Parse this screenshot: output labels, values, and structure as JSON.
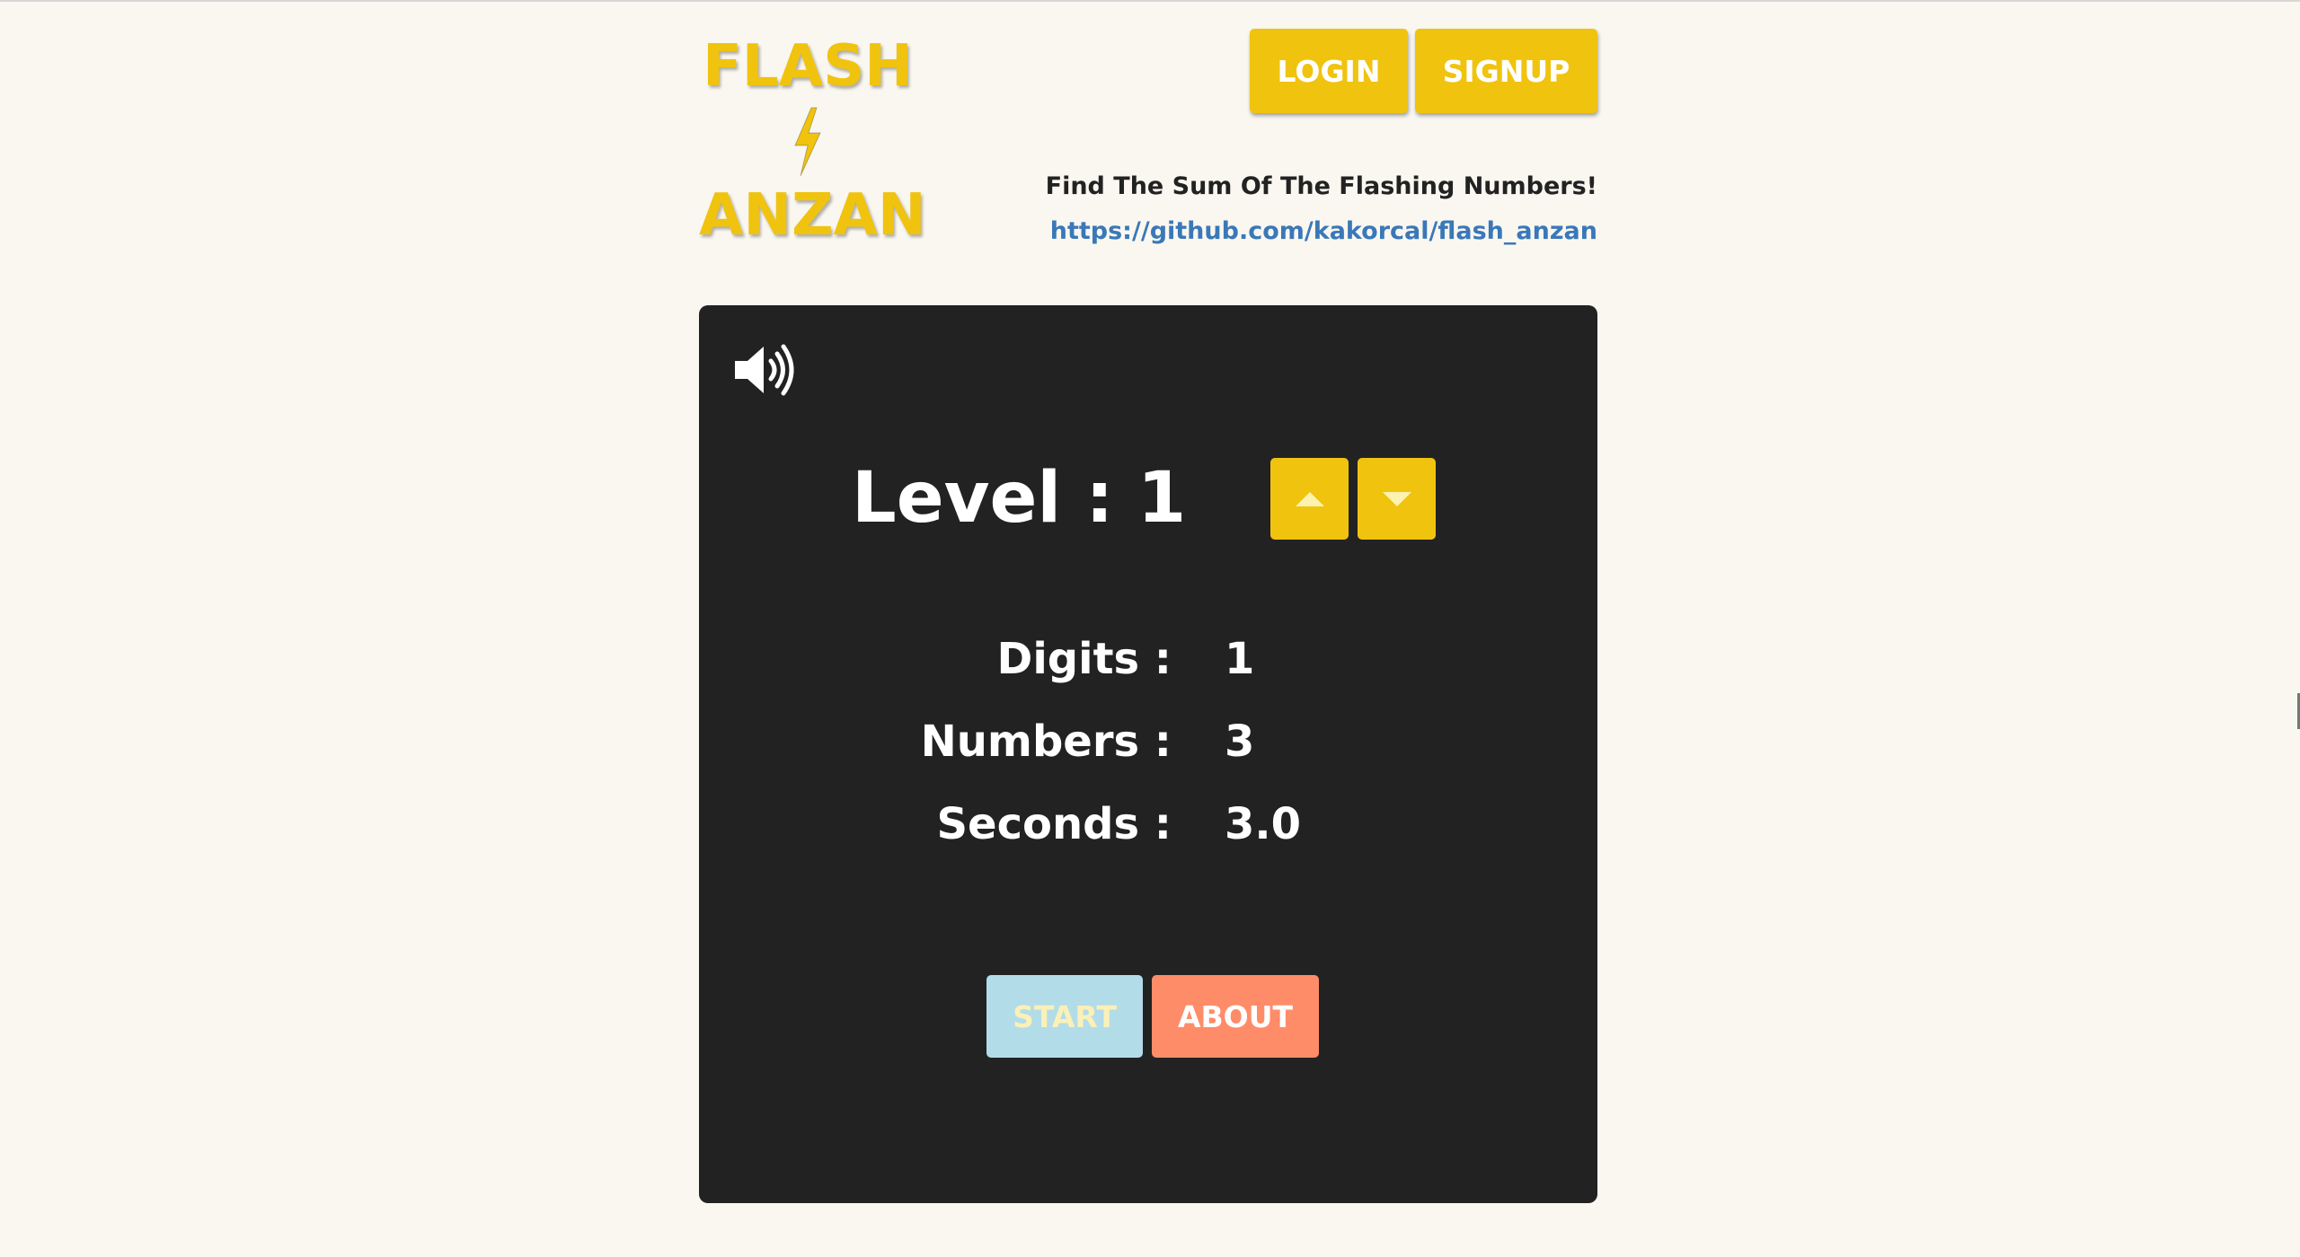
{
  "header": {
    "logo_top": "FLASH",
    "logo_bottom": "ANZAN",
    "login_label": "LOGIN",
    "signup_label": "SIGNUP",
    "tagline": "Find The Sum Of The Flashing Numbers!",
    "repo_link": "https://github.com/kakorcal/flash_anzan"
  },
  "panel": {
    "sound_icon": "volume-high-icon",
    "level_label": "Level :",
    "level_value": "1",
    "level_up_icon": "caret-up-icon",
    "level_down_icon": "caret-down-icon",
    "stats": [
      {
        "label": "Digits :",
        "value": "1"
      },
      {
        "label": "Numbers :",
        "value": "3"
      },
      {
        "label": "Seconds :",
        "value": "3.0"
      }
    ],
    "start_label": "START",
    "about_label": "ABOUT"
  },
  "colors": {
    "brand_yellow": "#f0c30f",
    "page_bg": "#faf7f0",
    "panel_bg": "#222222",
    "start_bg": "#b3dce9",
    "about_bg": "#ff8c69",
    "link_blue": "#3a78b8"
  }
}
